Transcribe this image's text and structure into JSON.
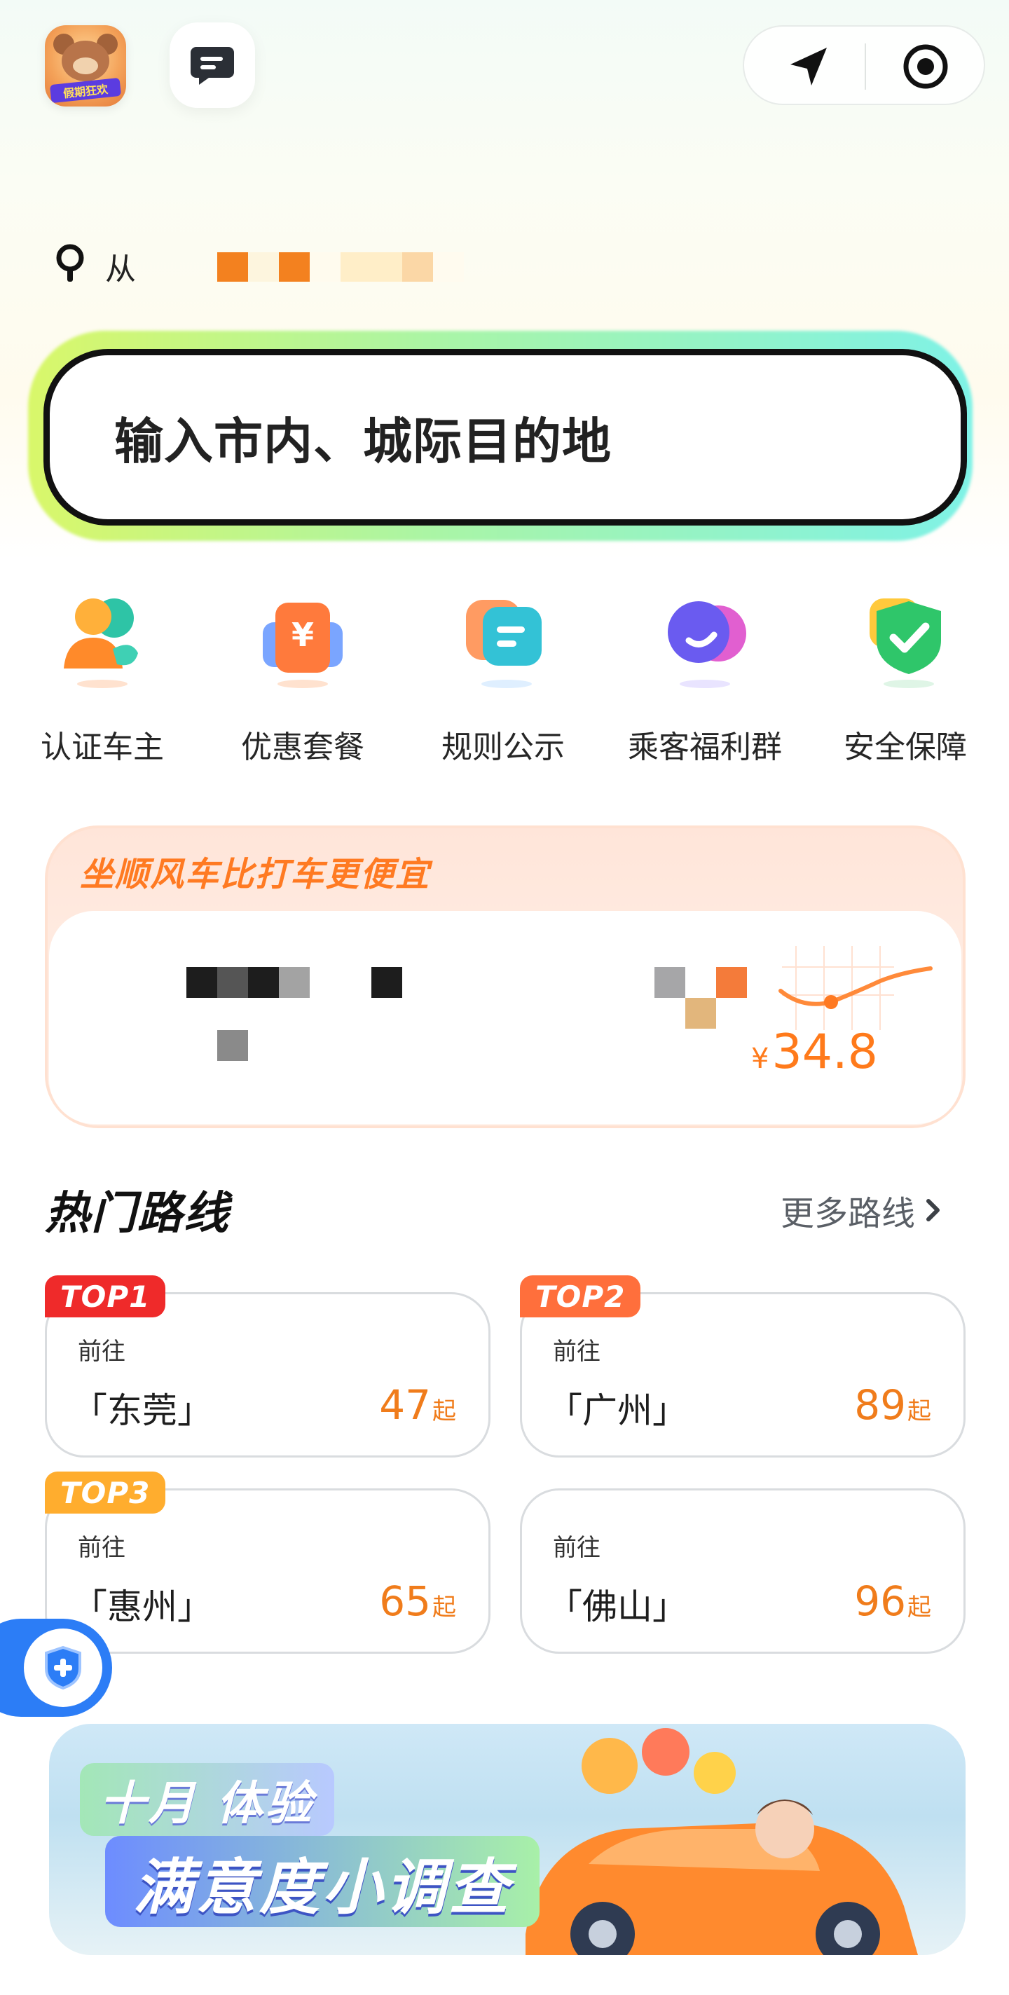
{
  "header": {
    "avatar_badge": "假期狂欢",
    "message_icon": "chat-bubble-icon",
    "nav_icon": "navigation-arrow-icon",
    "locate_icon": "target-icon"
  },
  "from": {
    "label": "从"
  },
  "search": {
    "placeholder": "输入市内、城际目的地"
  },
  "actions": [
    {
      "label": "认证车主",
      "icon": "verified-driver-icon"
    },
    {
      "label": "优惠套餐",
      "icon": "coupon-yen-icon"
    },
    {
      "label": "规则公示",
      "icon": "rules-doc-icon"
    },
    {
      "label": "乘客福利群",
      "icon": "group-chat-icon"
    },
    {
      "label": "安全保障",
      "icon": "safety-shield-icon"
    }
  ],
  "promo": {
    "title": "坐顺风车比打车更便宜",
    "currency": "¥",
    "price": "34.8"
  },
  "hot_routes": {
    "title": "热门路线",
    "more": "更多路线",
    "items": [
      {
        "tag": "TOP1",
        "goto": "前往",
        "city": "「东莞」",
        "price": "47",
        "suffix": "起"
      },
      {
        "tag": "TOP2",
        "goto": "前往",
        "city": "「广州」",
        "price": "89",
        "suffix": "起"
      },
      {
        "tag": "TOP3",
        "goto": "前往",
        "city": "「惠州」",
        "price": "65",
        "suffix": "起"
      },
      {
        "tag": "",
        "goto": "前往",
        "city": "「佛山」",
        "price": "96",
        "suffix": "起"
      }
    ]
  },
  "banner": {
    "line1": "十月 体验",
    "line2": "满意度小调查"
  },
  "colors": {
    "accent_orange": "#f07c1b",
    "top1": "#ef2a2a",
    "top2": "#ff6f3c",
    "top3": "#ffad2e",
    "fab_blue": "#2c7df6"
  }
}
